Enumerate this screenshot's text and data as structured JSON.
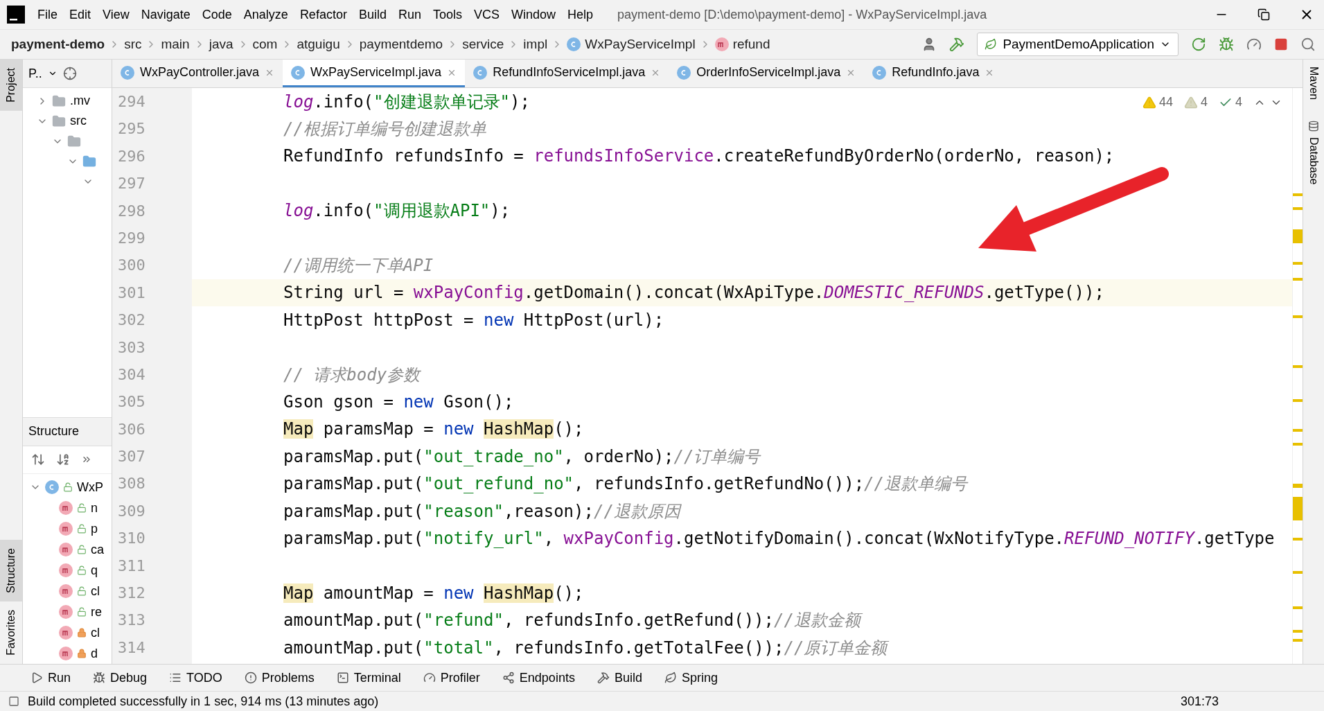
{
  "menu_bar": {
    "items": [
      "File",
      "Edit",
      "View",
      "Navigate",
      "Code",
      "Analyze",
      "Refactor",
      "Build",
      "Run",
      "Tools",
      "VCS",
      "Window",
      "Help"
    ],
    "title": "payment-demo [D:\\demo\\payment-demo] - WxPayServiceImpl.java"
  },
  "navigation_bar": {
    "breadcrumbs": [
      {
        "label": "payment-demo",
        "kind": "project"
      },
      {
        "label": "src",
        "kind": "folder"
      },
      {
        "label": "main",
        "kind": "folder"
      },
      {
        "label": "java",
        "kind": "folder"
      },
      {
        "label": "com",
        "kind": "folder"
      },
      {
        "label": "atguigu",
        "kind": "folder"
      },
      {
        "label": "paymentdemo",
        "kind": "folder"
      },
      {
        "label": "service",
        "kind": "folder"
      },
      {
        "label": "impl",
        "kind": "folder"
      },
      {
        "label": "WxPayServiceImpl",
        "kind": "class"
      },
      {
        "label": "refund",
        "kind": "method"
      }
    ],
    "run_configuration": "PaymentDemoApplication"
  },
  "left_strip": [
    {
      "label": "Project",
      "selected": true
    },
    {
      "label": "Structure",
      "selected": true
    },
    {
      "label": "Favorites",
      "selected": false
    }
  ],
  "project_panel": {
    "title": "P..",
    "tree": [
      {
        "label": ".mv",
        "kind": "folder",
        "expanded": false
      },
      {
        "label": "src",
        "kind": "folder",
        "expanded": true,
        "children": [
          {
            "kind": "folder",
            "expanded": true,
            "children": [
              {
                "kind": "source",
                "expanded": true,
                "children": [
                  {
                    "expanded": true
                  }
                ]
              }
            ]
          }
        ]
      }
    ]
  },
  "structure_panel": {
    "title": "Structure",
    "tree": [
      {
        "label": "WxP",
        "kind": "class",
        "expanded": true,
        "children": [
          {
            "label": "n",
            "kind": "method",
            "locked": false
          },
          {
            "label": "p",
            "kind": "method",
            "locked": false
          },
          {
            "label": "ca",
            "kind": "method",
            "locked": false
          },
          {
            "label": "q",
            "kind": "method",
            "locked": false
          },
          {
            "label": "cl",
            "kind": "method",
            "locked": false
          },
          {
            "label": "re",
            "kind": "method",
            "locked": false
          },
          {
            "label": "cl",
            "kind": "method",
            "locked": true
          },
          {
            "label": "d",
            "kind": "method",
            "locked": true
          }
        ]
      }
    ]
  },
  "editor_tabs": [
    {
      "label": "WxPayController.java",
      "selected": false
    },
    {
      "label": "WxPayServiceImpl.java",
      "selected": true
    },
    {
      "label": "RefundInfoServiceImpl.java",
      "selected": false
    },
    {
      "label": "OrderInfoServiceImpl.java",
      "selected": false
    },
    {
      "label": "RefundInfo.java",
      "selected": false
    }
  ],
  "inspections": {
    "warnings": "44",
    "weak_warnings": "4",
    "typos": "4"
  },
  "code": {
    "lines": [
      {
        "number": "294",
        "current": false,
        "tokens": [
          {
            "kind": "static",
            "text": "log"
          },
          {
            "kind": "plain",
            "text": ".info("
          },
          {
            "kind": "string",
            "text": "\"创建退款单记录\""
          },
          {
            "kind": "plain",
            "text": ");"
          }
        ]
      },
      {
        "number": "295",
        "current": false,
        "tokens": [
          {
            "kind": "comment",
            "text": "//根据订单编号创建退款单"
          }
        ]
      },
      {
        "number": "296",
        "current": false,
        "tokens": [
          {
            "kind": "plain",
            "text": "RefundInfo refundsInfo = "
          },
          {
            "kind": "field",
            "text": "refundsInfoService"
          },
          {
            "kind": "plain",
            "text": ".createRefundByOrderNo(orderNo, reason);"
          }
        ]
      },
      {
        "number": "297",
        "current": false
      },
      {
        "number": "298",
        "current": false,
        "tokens": [
          {
            "kind": "static",
            "text": "log"
          },
          {
            "kind": "plain",
            "text": ".info("
          },
          {
            "kind": "string",
            "text": "\"调用退款API\""
          },
          {
            "kind": "plain",
            "text": ");"
          }
        ]
      },
      {
        "number": "299",
        "current": false
      },
      {
        "number": "300",
        "current": false,
        "tokens": [
          {
            "kind": "comment",
            "text": "//调用统一下单API"
          }
        ]
      },
      {
        "number": "301",
        "current": true,
        "tokens": [
          {
            "kind": "plain",
            "text": "String url = "
          },
          {
            "kind": "field",
            "text": "wxPayConfig"
          },
          {
            "kind": "plain",
            "text": ".getDomain().concat(WxApiType."
          },
          {
            "kind": "static",
            "text": "DOMESTIC_REFUNDS"
          },
          {
            "kind": "plain",
            "text": ".getType());"
          }
        ]
      },
      {
        "number": "302",
        "current": false,
        "tokens": [
          {
            "kind": "plain",
            "text": "HttpPost httpPost = "
          },
          {
            "kind": "keyword",
            "text": "new"
          },
          {
            "kind": "plain",
            "text": " HttpPost(url);"
          }
        ]
      },
      {
        "number": "303",
        "current": false
      },
      {
        "number": "304",
        "current": false,
        "tokens": [
          {
            "kind": "comment",
            "text": "// 请求body参数"
          }
        ]
      },
      {
        "number": "305",
        "current": false,
        "tokens": [
          {
            "kind": "plain",
            "text": "Gson gson = "
          },
          {
            "kind": "keyword",
            "text": "new"
          },
          {
            "kind": "plain",
            "text": " Gson();"
          }
        ]
      },
      {
        "number": "306",
        "current": false,
        "tokens": [
          {
            "kind": "warn",
            "text": "Map"
          },
          {
            "kind": "plain",
            "text": " paramsMap = "
          },
          {
            "kind": "keyword",
            "text": "new "
          },
          {
            "kind": "warn",
            "text": "HashMap"
          },
          {
            "kind": "plain",
            "text": "();"
          }
        ]
      },
      {
        "number": "307",
        "current": false,
        "tokens": [
          {
            "kind": "plain",
            "text": "paramsMap.put("
          },
          {
            "kind": "string",
            "text": "\"out_trade_no\""
          },
          {
            "kind": "plain",
            "text": ", orderNo);"
          },
          {
            "kind": "comment",
            "text": "//订单编号"
          }
        ]
      },
      {
        "number": "308",
        "current": false,
        "tokens": [
          {
            "kind": "plain",
            "text": "paramsMap.put("
          },
          {
            "kind": "string",
            "text": "\"out_refund_no\""
          },
          {
            "kind": "plain",
            "text": ", refundsInfo.getRefundNo());"
          },
          {
            "kind": "comment",
            "text": "//退款单编号"
          }
        ]
      },
      {
        "number": "309",
        "current": false,
        "tokens": [
          {
            "kind": "plain",
            "text": "paramsMap.put("
          },
          {
            "kind": "string",
            "text": "\"reason\""
          },
          {
            "kind": "plain",
            "text": ",reason);"
          },
          {
            "kind": "comment",
            "text": "//退款原因"
          }
        ]
      },
      {
        "number": "310",
        "current": false,
        "tokens": [
          {
            "kind": "plain",
            "text": "paramsMap.put("
          },
          {
            "kind": "string",
            "text": "\"notify_url\""
          },
          {
            "kind": "plain",
            "text": ", "
          },
          {
            "kind": "field",
            "text": "wxPayConfig"
          },
          {
            "kind": "plain",
            "text": ".getNotifyDomain().concat(WxNotifyType."
          },
          {
            "kind": "static",
            "text": "REFUND_NOTIFY"
          },
          {
            "kind": "plain",
            "text": ".getType"
          }
        ]
      },
      {
        "number": "311",
        "current": false
      },
      {
        "number": "312",
        "current": false,
        "tokens": [
          {
            "kind": "warn",
            "text": "Map"
          },
          {
            "kind": "plain",
            "text": " amountMap = "
          },
          {
            "kind": "keyword",
            "text": "new "
          },
          {
            "kind": "warn",
            "text": "HashMap"
          },
          {
            "kind": "plain",
            "text": "();"
          }
        ]
      },
      {
        "number": "313",
        "current": false,
        "tokens": [
          {
            "kind": "plain",
            "text": "amountMap.put("
          },
          {
            "kind": "string",
            "text": "\"refund\""
          },
          {
            "kind": "plain",
            "text": ", refundsInfo.getRefund());"
          },
          {
            "kind": "comment",
            "text": "//退款金额"
          }
        ]
      },
      {
        "number": "314",
        "current": false,
        "tokens": [
          {
            "kind": "plain",
            "text": "amountMap.put("
          },
          {
            "kind": "string",
            "text": "\"total\""
          },
          {
            "kind": "plain",
            "text": ", refundsInfo.getTotalFee());"
          },
          {
            "kind": "comment",
            "text": "//原订单金额"
          }
        ]
      }
    ]
  },
  "right_strip": [
    "Maven",
    "Database"
  ],
  "tool_windows": [
    {
      "label": "Run"
    },
    {
      "label": "Debug"
    },
    {
      "label": "TODO"
    },
    {
      "label": "Problems"
    },
    {
      "label": "Terminal"
    },
    {
      "label": "Profiler"
    },
    {
      "label": "Endpoints"
    },
    {
      "label": "Build"
    },
    {
      "label": "Spring"
    }
  ],
  "status_bar": {
    "message": "Build completed successfully in 1 sec, 914 ms (13 minutes ago)",
    "position": "301:73"
  }
}
